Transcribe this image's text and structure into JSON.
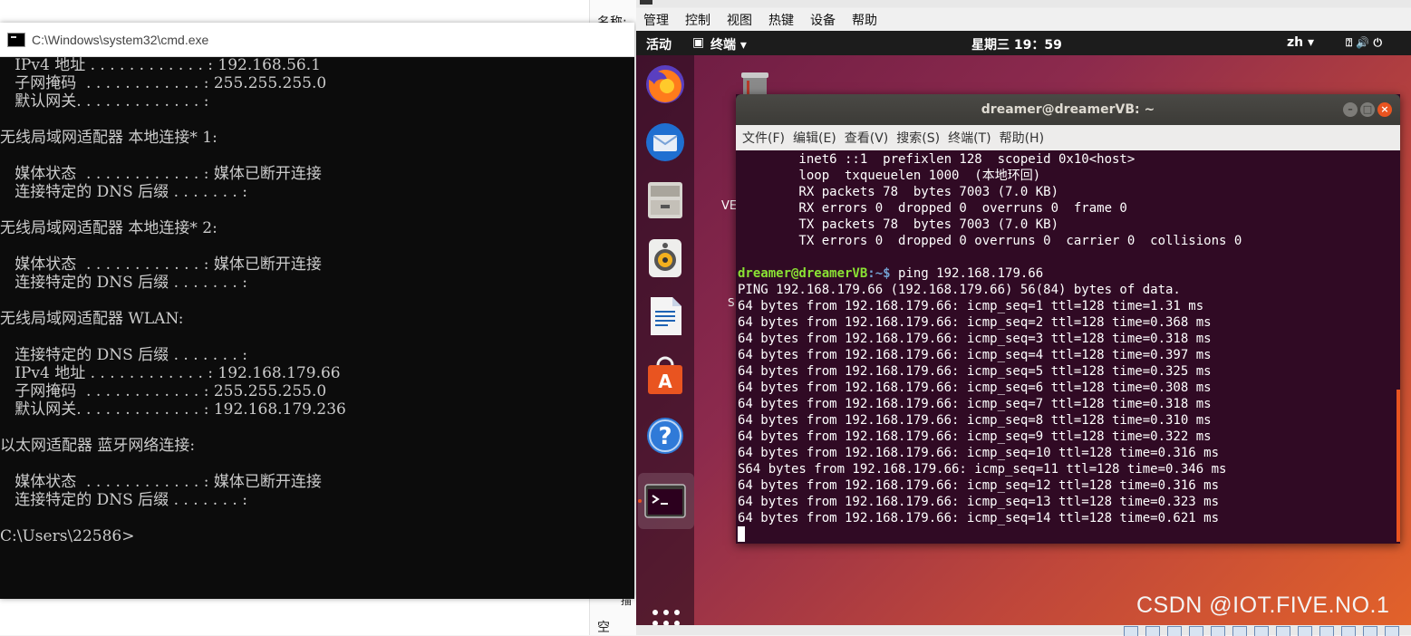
{
  "explorer": {
    "label_top": "名称:",
    "label_bottom": "空",
    "label_icon": "描"
  },
  "cmd": {
    "title": "C:\\Windows\\system32\\cmd.exe",
    "lines": [
      "   IPv4 地址 . . . . . . . . . . . . : 192.168.56.1",
      "   子网掩码  . . . . . . . . . . . . : 255.255.255.0",
      "   默认网关. . . . . . . . . . . . . :",
      "",
      "无线局域网适配器 本地连接* 1:",
      "",
      "   媒体状态  . . . . . . . . . . . . : 媒体已断开连接",
      "   连接特定的 DNS 后缀 . . . . . . . :",
      "",
      "无线局域网适配器 本地连接* 2:",
      "",
      "   媒体状态  . . . . . . . . . . . . : 媒体已断开连接",
      "   连接特定的 DNS 后缀 . . . . . . . :",
      "",
      "无线局域网适配器 WLAN:",
      "",
      "   连接特定的 DNS 后缀 . . . . . . . :",
      "   IPv4 地址 . . . . . . . . . . . . : 192.168.179.66",
      "   子网掩码  . . . . . . . . . . . . : 255.255.255.0",
      "   默认网关. . . . . . . . . . . . . : 192.168.179.236",
      "",
      "以太网适配器 蓝牙网络连接:",
      "",
      "   媒体状态  . . . . . . . . . . . . : 媒体已断开连接",
      "   连接特定的 DNS 后缀 . . . . . . . :",
      "",
      "C:\\Users\\22586>"
    ]
  },
  "vbox": {
    "menu": [
      "管理",
      "控制",
      "视图",
      "热键",
      "设备",
      "帮助"
    ]
  },
  "ubuntu": {
    "activities": "活动",
    "app_menu": "终端 ▾",
    "clock": "星期三 19：59",
    "lang": "zh ▾",
    "tray": "⍰ 🔊 ⏻",
    "desktop_ve": "VE",
    "desktop_s": "S",
    "watermark": "CSDN @IOT.FIVE.NO.1"
  },
  "dock": {
    "items": [
      "firefox-icon",
      "thunderbird-icon",
      "files-icon",
      "rhythmbox-icon",
      "libreoffice-writer-icon",
      "software-center-icon",
      "help-icon",
      "terminal-icon"
    ]
  },
  "terminal": {
    "title": "dreamer@dreamerVB: ~",
    "menu": [
      "文件(F)",
      "编辑(E)",
      "查看(V)",
      "搜索(S)",
      "终端(T)",
      "帮助(H)"
    ],
    "buttons": {
      "minimize": "–",
      "maximize": "□",
      "close": "×"
    },
    "prompt_user": "dreamer@dreamerVB",
    "prompt_path": ":~$ ",
    "command": "ping 192.168.179.66",
    "pre_lines": [
      "        inet6 ::1  prefixlen 128  scopeid 0x10<host>",
      "        loop  txqueuelen 1000  (本地环回)",
      "        RX packets 78  bytes 7003 (7.0 KB)",
      "        RX errors 0  dropped 0  overruns 0  frame 0",
      "        TX packets 78  bytes 7003 (7.0 KB)",
      "        TX errors 0  dropped 0 overruns 0  carrier 0  collisions 0",
      ""
    ],
    "post_lines": [
      "PING 192.168.179.66 (192.168.179.66) 56(84) bytes of data.",
      "64 bytes from 192.168.179.66: icmp_seq=1 ttl=128 time=1.31 ms",
      "64 bytes from 192.168.179.66: icmp_seq=2 ttl=128 time=0.368 ms",
      "64 bytes from 192.168.179.66: icmp_seq=3 ttl=128 time=0.318 ms",
      "64 bytes from 192.168.179.66: icmp_seq=4 ttl=128 time=0.397 ms",
      "64 bytes from 192.168.179.66: icmp_seq=5 ttl=128 time=0.325 ms",
      "64 bytes from 192.168.179.66: icmp_seq=6 ttl=128 time=0.308 ms",
      "64 bytes from 192.168.179.66: icmp_seq=7 ttl=128 time=0.318 ms",
      "64 bytes from 192.168.179.66: icmp_seq=8 ttl=128 time=0.310 ms",
      "64 bytes from 192.168.179.66: icmp_seq=9 ttl=128 time=0.322 ms",
      "64 bytes from 192.168.179.66: icmp_seq=10 ttl=128 time=0.316 ms",
      "S64 bytes from 192.168.179.66: icmp_seq=11 ttl=128 time=0.346 ms",
      "64 bytes from 192.168.179.66: icmp_seq=12 ttl=128 time=0.316 ms",
      "64 bytes from 192.168.179.66: icmp_seq=13 ttl=128 time=0.323 ms",
      "64 bytes from 192.168.179.66: icmp_seq=14 ttl=128 time=0.621 ms"
    ]
  },
  "colors": {
    "ubuntu_orange": "#e95420",
    "terminal_bg": "#300a24",
    "prompt_green": "#8ae234",
    "prompt_blue": "#729fcf"
  }
}
